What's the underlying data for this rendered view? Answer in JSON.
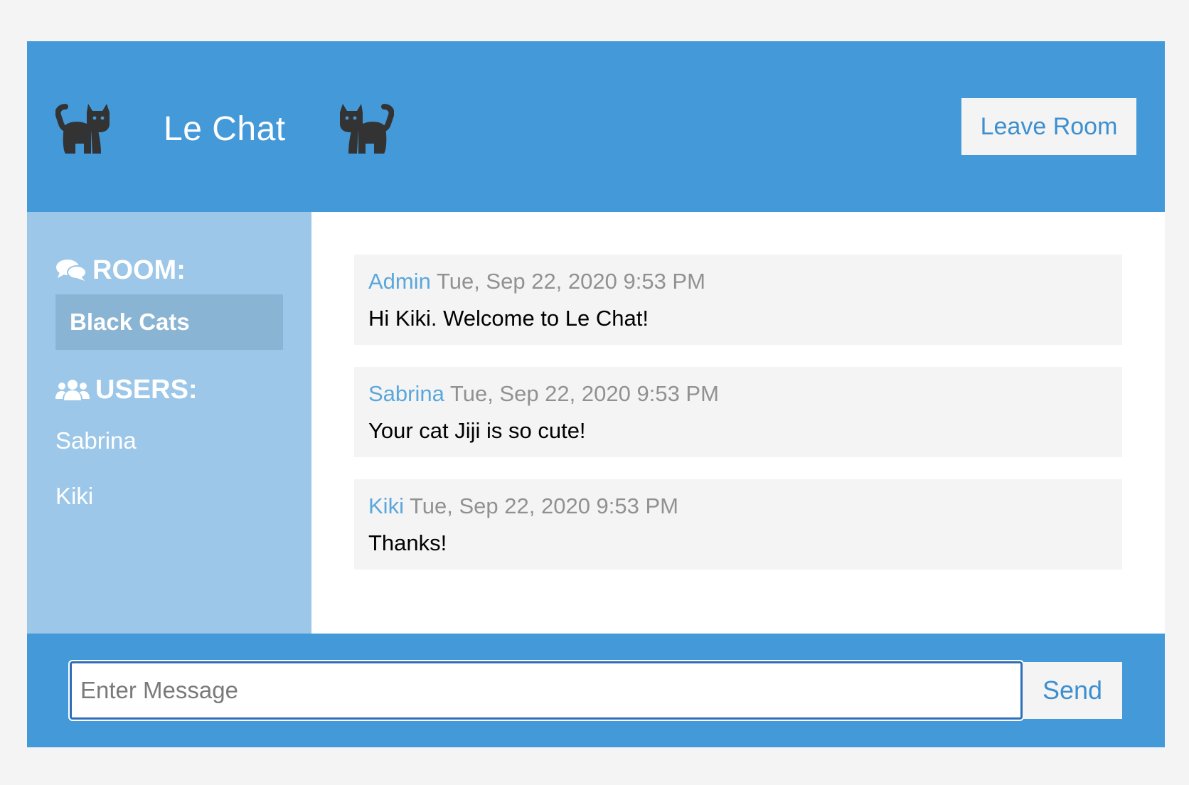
{
  "header": {
    "title": "Le Chat",
    "leave_button": "Leave Room",
    "icon_color": "#333333",
    "background": "#4499d8"
  },
  "sidebar": {
    "room_heading": "ROOM:",
    "room_name": "Black Cats",
    "users_heading": "USERS:",
    "users": [
      "Sabrina",
      "Kiki"
    ]
  },
  "messages": [
    {
      "author": "Admin",
      "time": "Tue, Sep 22, 2020 9:53 PM",
      "text": "Hi Kiki. Welcome to Le Chat!"
    },
    {
      "author": "Sabrina",
      "time": "Tue, Sep 22, 2020 9:53 PM",
      "text": "Your cat Jiji is so cute!"
    },
    {
      "author": "Kiki",
      "time": "Tue, Sep 22, 2020 9:53 PM",
      "text": "Thanks!"
    }
  ],
  "form": {
    "placeholder": "Enter Message",
    "value": "",
    "send_label": "Send"
  },
  "icons": {
    "header_left": "cat-icon",
    "header_right": "cat-icon",
    "room": "comments-icon",
    "users": "users-icon"
  }
}
